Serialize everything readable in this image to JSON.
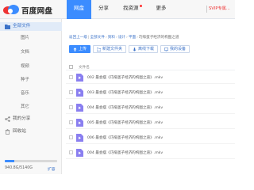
{
  "app": {
    "name": "百度网盘"
  },
  "nav": [
    {
      "label": "网盘",
      "active": true,
      "dot": false
    },
    {
      "label": "分享",
      "active": false,
      "dot": false
    },
    {
      "label": "找资源",
      "active": false,
      "dot": true
    },
    {
      "label": "更多",
      "active": false,
      "dot": false
    }
  ],
  "header": {
    "vip_link": "SVIP专属..."
  },
  "sidebar": {
    "items": [
      {
        "label": "全部文件",
        "icon": "folder-icon",
        "active": true
      },
      {
        "label": "图片"
      },
      {
        "label": "文档"
      },
      {
        "label": "视频"
      },
      {
        "label": "种子"
      },
      {
        "label": "音乐"
      },
      {
        "label": "其它"
      },
      {
        "label": "我的分享",
        "icon": "share-icon"
      },
      {
        "label": "回收站",
        "icon": "trash-icon"
      }
    ],
    "storage": {
      "text": "940.8G/5140G",
      "used_fraction": 0.18,
      "expand_label": "扩容"
    }
  },
  "breadcrumb": {
    "items": [
      "返回上一级",
      "全部文件",
      "资料",
      "设计",
      "平面",
      "巧绯蛋子经济的构图之道"
    ]
  },
  "toolbar": {
    "upload": "上传",
    "new_folder": "新建文件夹",
    "offline": "离线下载",
    "devices": "我的设备"
  },
  "list": {
    "header": "文件名",
    "files": [
      "002 最会摆《巧绯蛋子经济的构图之道》.mkv",
      "003 最会摆《巧绯蛋子经济的构图之道》.mkv",
      "004 最会摆《巧绯蛋子经济的构图之道》.mkv",
      "005 最会摆《巧绯蛋子经济的构图之道》.mkv",
      "006 最会摆《巧绯蛋子经济的构图之道》.mkv",
      "004 最会摆《巧绯蛋子经济的构图之道》.mkv"
    ]
  },
  "colors": {
    "accent": "#3b8cff",
    "sidebar_active": "#e1ebf8",
    "file_icon": "#8a7ff0"
  }
}
